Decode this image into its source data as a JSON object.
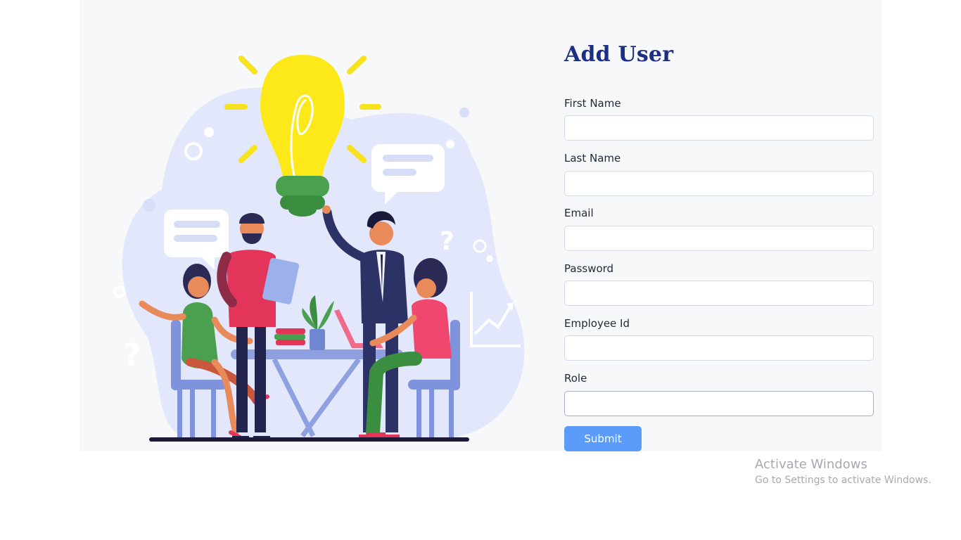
{
  "form": {
    "title": "Add User",
    "fields": [
      {
        "label": "First Name",
        "value": ""
      },
      {
        "label": "Last Name",
        "value": ""
      },
      {
        "label": "Email",
        "value": ""
      },
      {
        "label": "Password",
        "value": ""
      },
      {
        "label": "Employee Id",
        "value": ""
      },
      {
        "label": "Role",
        "value": ""
      }
    ],
    "submit_label": "Submit"
  },
  "watermark": {
    "title": "Activate Windows",
    "subtitle": "Go to Settings to activate Windows."
  },
  "colors": {
    "title": "#1d2e86",
    "button": "#5b9cfa",
    "card_background": "#f7f8fa"
  }
}
